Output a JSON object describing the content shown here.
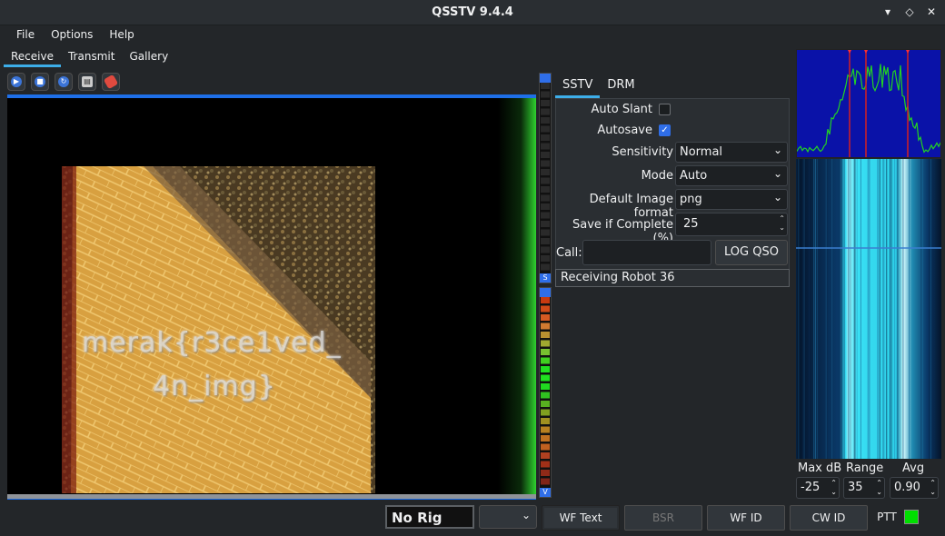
{
  "window": {
    "title": "QSSTV 9.4.4"
  },
  "menu": [
    "File",
    "Options",
    "Help"
  ],
  "main_tabs": [
    "Receive",
    "Transmit",
    "Gallery"
  ],
  "rx_image_text": {
    "line1": "merak{r3ce1ved_",
    "line2": "4n_img}"
  },
  "vu": {
    "top_cap": "S",
    "bottom_cap": "V"
  },
  "mode_tabs": [
    "SSTV",
    "DRM"
  ],
  "sstv": {
    "auto_slant_label": "Auto Slant",
    "autosave_label": "Autosave",
    "sensitivity_label": "Sensitivity",
    "sensitivity_value": "Normal",
    "mode_label": "Mode",
    "mode_value": "Auto",
    "image_format_label": "Default Image format",
    "image_format_value": "png",
    "save_complete_label": "Save if Complete (%)",
    "save_complete_value": "25",
    "call_label": "Call:",
    "log_qso": "LOG QSO",
    "status": "Receiving Robot 36",
    "auto_slant_checked": false,
    "autosave_checked": true
  },
  "right": {
    "maxdb_label": "Max dB",
    "range_label": "Range",
    "avg_label": "Avg",
    "maxdb_value": "-25",
    "range_value": "35",
    "avg_value": "0.90"
  },
  "statusbar": {
    "rig": "No Rig",
    "wf_text": "WF Text",
    "bsr": "BSR",
    "wf_id": "WF ID",
    "cw_id": "CW ID",
    "ptt": "PTT"
  },
  "colors": {
    "accent": "#1e6fe8",
    "ptt_led": "#00e000",
    "spectrum_bg": "#0a12a8"
  }
}
